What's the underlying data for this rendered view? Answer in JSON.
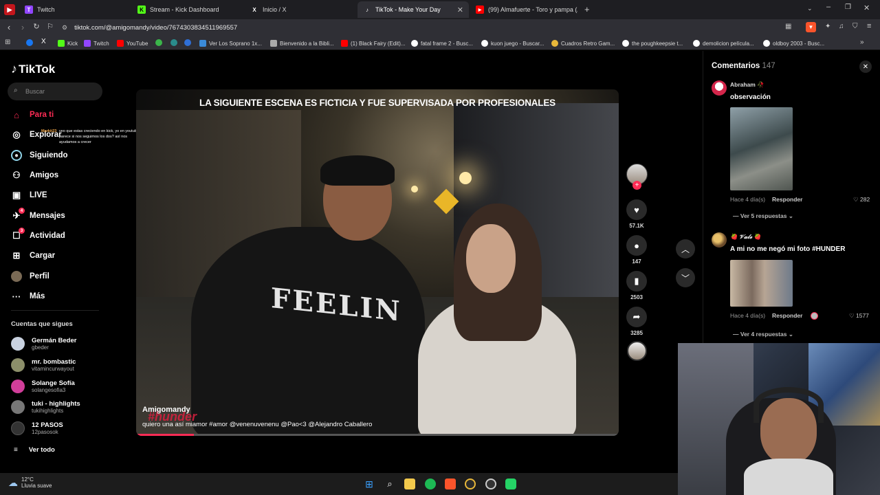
{
  "browser": {
    "tabs": [
      {
        "label": "Twitch",
        "fav": "T",
        "color": "#9146ff"
      },
      {
        "label": "Stream - Kick Dashboard",
        "fav": "K",
        "color": "#53fc18"
      },
      {
        "label": "Inicio / X",
        "fav": "X",
        "color": "#000000"
      },
      {
        "label": "TikTok - Make Your Day",
        "fav": "♪",
        "color": "#000000"
      },
      {
        "label": "(99) Almafuerte - Toro y pampa (AUD",
        "fav": "▶",
        "color": "#ff0000"
      }
    ],
    "url": "tiktok.com/@amigomandy/video/7674303834511969557",
    "bookmarks": [
      "Kick",
      "Twitch",
      "YouTube",
      "Ver Los Soprano 1x...",
      "Bienvenido a la Bibli...",
      "(1) Black Fairy (Edit)...",
      "fatal frame 2 - Busc...",
      "kuon juego - Buscar...",
      "Cuadros Retro Gam...",
      "the poughkeepsie t...",
      "demolicion película...",
      "oldboy 2003 - Busc..."
    ]
  },
  "tiktok": {
    "logo": "TikTok",
    "search_placeholder": "Buscar",
    "nav": [
      {
        "label": "Para ti",
        "icon": "⌂",
        "active": true
      },
      {
        "label": "Explorar",
        "icon": "◎"
      },
      {
        "label": "Siguiendo",
        "icon": "●"
      },
      {
        "label": "Amigos",
        "icon": "⚇"
      },
      {
        "label": "LIVE",
        "icon": "▣"
      },
      {
        "label": "Mensajes",
        "icon": "✈",
        "badge": "4"
      },
      {
        "label": "Actividad",
        "icon": "☐",
        "badge": "3"
      },
      {
        "label": "Cargar",
        "icon": "⊞"
      },
      {
        "label": "Perfil",
        "icon": "●"
      },
      {
        "label": "Más",
        "icon": "···"
      }
    ],
    "chat_overlay": {
      "user": "Markit23",
      "message": "veo que estas creciendo en kick, yo en youtube, te parece si nos seguimos los dos? así nos ayudamos a crecer"
    },
    "following_title": "Cuentas que sigues",
    "following": [
      {
        "name": "Germán Beder",
        "handle": "gbeder",
        "color": "#c9d2e0"
      },
      {
        "name": "mr. bombastic",
        "handle": "vitamincurwayout",
        "color": "#8c8f6a"
      },
      {
        "name": "Solange Sofía",
        "handle": "solangesofia3",
        "color": "#d13e9a"
      },
      {
        "name": "tuki - highlights",
        "handle": "tukihighlights",
        "color": "#777777"
      },
      {
        "name": "12 PASOS",
        "handle": "12pasosok",
        "color": "#333333"
      }
    ],
    "see_all": "Ver todo",
    "video": {
      "top_caption": "LA SIGUIENTE ESCENA ES FICTICIA Y FUE SUPERVISADA POR PROFESIONALES",
      "author": "Amigomandy",
      "hashtag_overlay": "#hunder",
      "description": "quiero una así miamor #amor @venenuvenenu @Pao<3 @Alejandro Caballero",
      "progress": 0.12
    },
    "actions": {
      "likes": "57.1K",
      "comments": "147",
      "saves": "2503",
      "shares": "3285"
    },
    "comments": {
      "title": "Comentarios",
      "count": "147",
      "items": [
        {
          "user": "Abraham 🥀",
          "text": "observación",
          "time": "Hace 4 día(s)",
          "reply": "Responder",
          "likes": "282",
          "more": "Ver 5 respuestas"
        },
        {
          "user": "🍓 𝓥𝓪𝓵𝓮 🍓",
          "text": "A mi no me negó mi foto #HUNDER",
          "time": "Hace 4 día(s)",
          "reply": "Responder",
          "likes": "1577",
          "more": "Ver 4 respuestas"
        }
      ]
    }
  },
  "taskbar": {
    "weather_temp": "12°C",
    "weather_desc": "Lluvia suave"
  }
}
